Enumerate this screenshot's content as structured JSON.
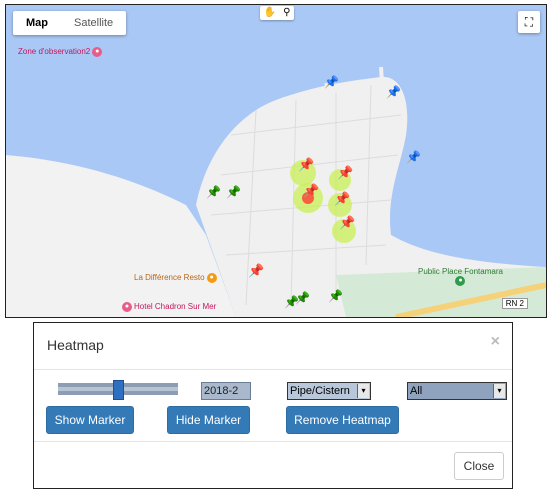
{
  "map": {
    "map_type_buttons": [
      "Map",
      "Satellite"
    ],
    "active_map_type": "Map",
    "tool_icons": [
      "hand-icon",
      "pin-icon"
    ],
    "fullscreen_icon": "fullscreen-icon",
    "pois": {
      "observation": "Zone d'observation2",
      "resto": "La Différence Resto",
      "hotel": "Hotel Chadron Sur Mer",
      "park": "Public Place Fontamara"
    },
    "road_label": "RN 2",
    "colors": {
      "water": "#aac8f5",
      "land": "#f2f2f2",
      "park": "#d4ead6",
      "heat": "#c8f04a",
      "hot": "#ff3b2f"
    },
    "markers": {
      "yellow": 8,
      "green": 6,
      "blue": 3
    }
  },
  "dialog": {
    "title": "Heatmap",
    "close_x": "×",
    "year_value": "2018-2",
    "slider_fraction": 0.5,
    "type_select": "Pipe/Cistern",
    "filter_select": "All",
    "caret": "▾",
    "buttons": {
      "show": "Show Marker",
      "hide": "Hide Marker",
      "remove": "Remove Heatmap",
      "close": "Close"
    }
  }
}
